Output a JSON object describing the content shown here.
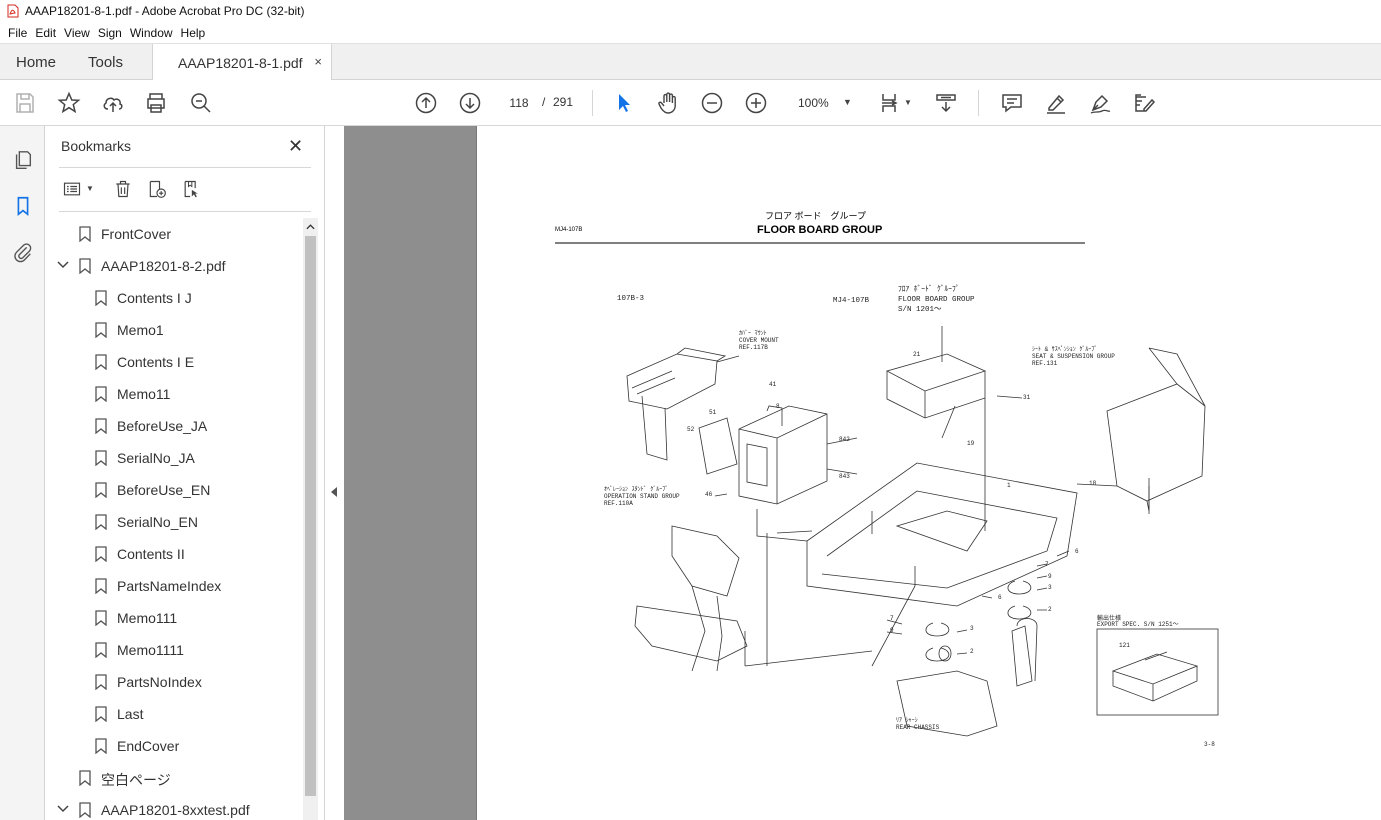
{
  "window": {
    "title": "AAAP18201-8-1.pdf - Adobe Acrobat Pro DC (32-bit)"
  },
  "menu": [
    "File",
    "Edit",
    "View",
    "Sign",
    "Window",
    "Help"
  ],
  "tabs": {
    "home": "Home",
    "tools": "Tools",
    "document": "AAAP18201-8-1.pdf",
    "close": "×"
  },
  "toolbar": {
    "page_current": "118",
    "page_sep": "/",
    "page_total": "291",
    "zoom": "100%"
  },
  "bookmarks": {
    "title": "Bookmarks",
    "close": "✕",
    "items": [
      {
        "label": "FrontCover",
        "level": 0,
        "expanded": null
      },
      {
        "label": "AAAP18201-8-2.pdf",
        "level": 0,
        "expanded": true
      },
      {
        "label": "Contents I J",
        "level": 1,
        "expanded": null
      },
      {
        "label": "Memo1",
        "level": 1,
        "expanded": null
      },
      {
        "label": "Contents I E",
        "level": 1,
        "expanded": null
      },
      {
        "label": "Memo11",
        "level": 1,
        "expanded": null
      },
      {
        "label": "BeforeUse_JA",
        "level": 1,
        "expanded": null
      },
      {
        "label": "SerialNo_JA",
        "level": 1,
        "expanded": null
      },
      {
        "label": "BeforeUse_EN",
        "level": 1,
        "expanded": null
      },
      {
        "label": "SerialNo_EN",
        "level": 1,
        "expanded": null
      },
      {
        "label": "Contents II",
        "level": 1,
        "expanded": null
      },
      {
        "label": "PartsNameIndex",
        "level": 1,
        "expanded": null
      },
      {
        "label": "Memo111",
        "level": 1,
        "expanded": null
      },
      {
        "label": "Memo1111",
        "level": 1,
        "expanded": null
      },
      {
        "label": "PartsNoIndex",
        "level": 1,
        "expanded": null
      },
      {
        "label": "Last",
        "level": 1,
        "expanded": null
      },
      {
        "label": "EndCover",
        "level": 1,
        "expanded": null
      },
      {
        "label": "空白ページ",
        "level": 0,
        "expanded": null
      },
      {
        "label": "AAAP18201-8xxtest.pdf",
        "level": 0,
        "expanded": true
      }
    ]
  },
  "drawing": {
    "header_code": "MJ4-107B",
    "header_jp": "フロア ボード　グループ",
    "header_en": "FLOOR BOARD GROUP",
    "fig_no": "107B-3",
    "title_code": "MJ4-107B",
    "title_jp": "ﾌﾛｱ ﾎﾞｰﾄﾞ ｸﾞﾙｰﾌﾟ",
    "title_en": "FLOOR BOARD GROUP",
    "title_sn": "S/N 1201～",
    "cover_jp": "ｶﾊﾞｰ ﾏｳﾝﾄ",
    "cover_en": "COVER MOUNT",
    "cover_ref": "REF.117B",
    "seat_jp": "ｼｰﾄ & ｻｽﾍﾟﾝｼｮﾝ ｸﾞﾙｰﾌﾟ",
    "seat_en": "SEAT & SUSPENSION GROUP",
    "seat_ref": "REF.131",
    "op_jp": "ｵﾍﾟﾚｰｼｮﾝ ｽﾀﾝﾄﾞ ｸﾞﾙｰﾌﾟ",
    "op_en": "OPERATION STAND GROUP",
    "op_ref": "REF.110A",
    "export_jp": "輸出仕様",
    "export_en": "EXPORT SPEC.  S/N 1251～",
    "rear_jp": "ﾘｱ ｼｬｰｼ",
    "rear_en": "REAR CHASSIS",
    "page_no": "3-8",
    "callouts": [
      "21",
      "31",
      "19",
      "41",
      "8",
      "51",
      "52",
      "842",
      "843",
      "46",
      "1",
      "18",
      "6",
      "7",
      "9",
      "3",
      "2",
      "6",
      "7",
      "9",
      "3",
      "2",
      "121"
    ]
  },
  "colors": {
    "accent": "#1473e6",
    "rail_active": "#1473e6",
    "doc_bg": "#8e8e8e"
  }
}
